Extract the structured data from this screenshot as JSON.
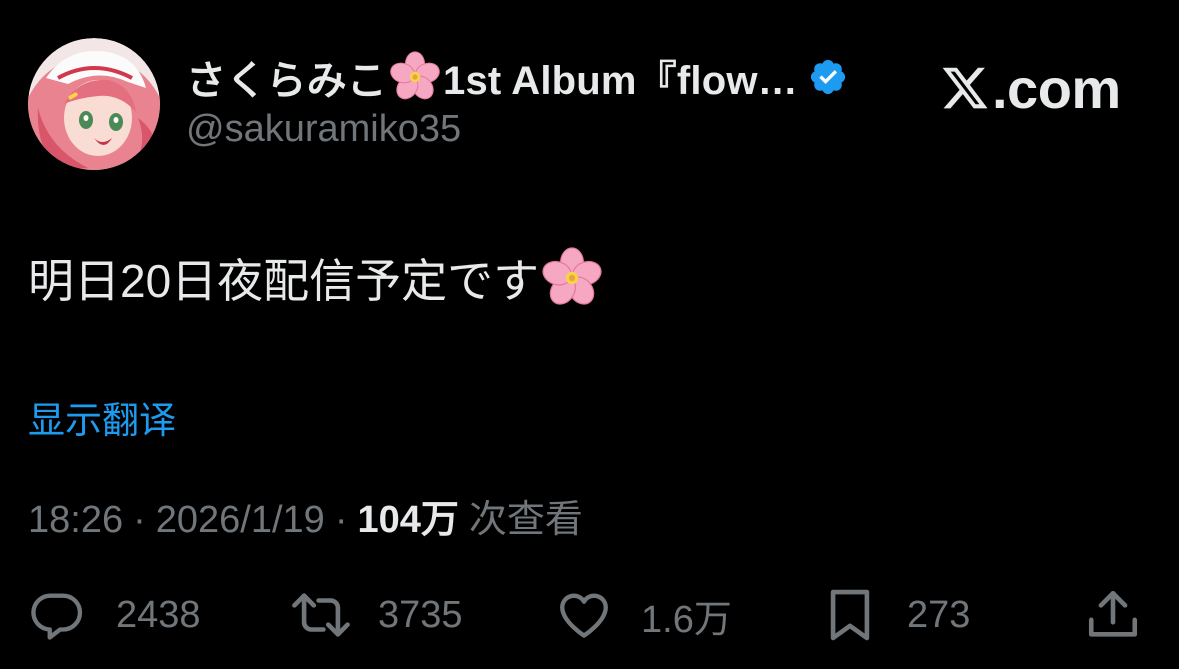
{
  "user": {
    "display_name": "さくらみこ",
    "display_name_suffix": "1st Album『flow…",
    "handle": "@sakuramiko35",
    "verified_icon": "verified-badge-icon"
  },
  "site": {
    "domain": ".com"
  },
  "tweet": {
    "text": "明日20日夜配信予定です",
    "translate_label": "显示翻译",
    "time": "18:26",
    "separator": "·",
    "date": "2026/1/19",
    "views_count": "104万",
    "views_label": "次查看"
  },
  "actions": {
    "reply_count": "2438",
    "retweet_count": "3735",
    "like_count": "1.6万",
    "bookmark_count": "273"
  },
  "colors": {
    "background": "#000000",
    "text": "#e7e9ea",
    "muted": "#71767b",
    "link": "#1d9bf0",
    "verified": "#1d9bf0"
  }
}
